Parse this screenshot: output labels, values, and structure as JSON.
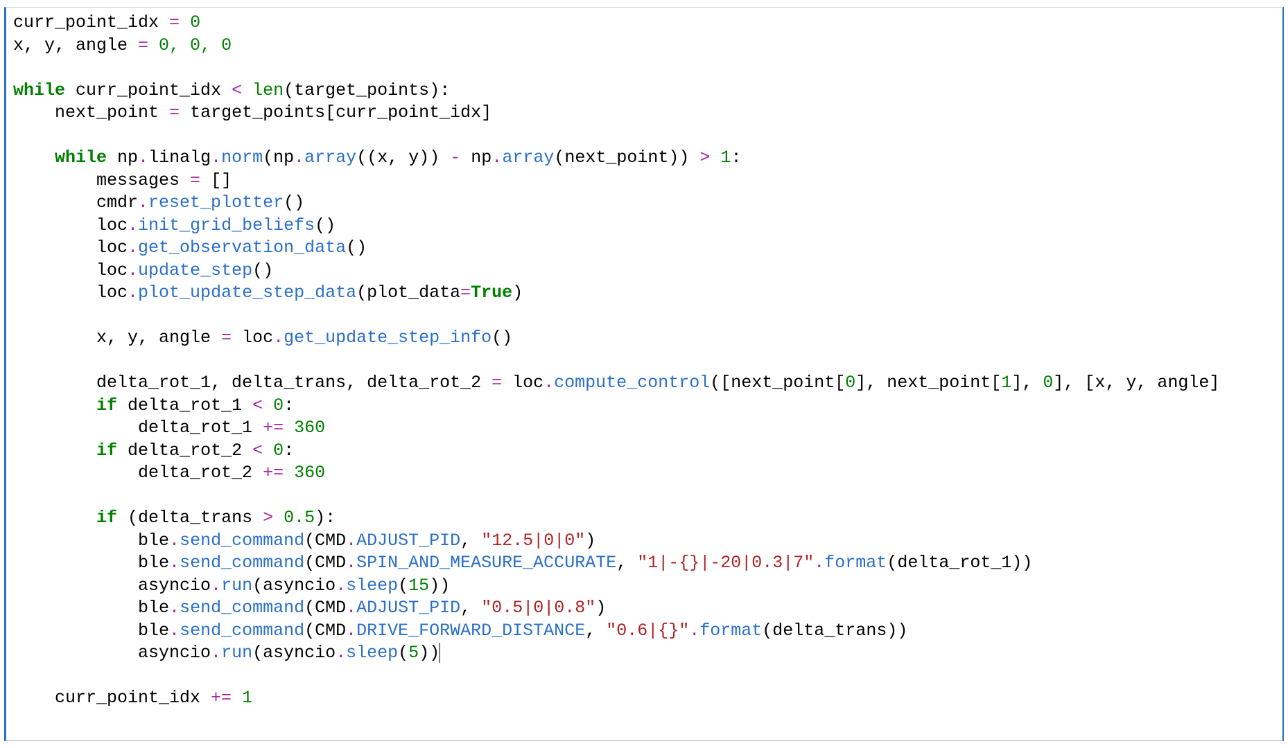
{
  "cell": {
    "interactable": true
  },
  "code": {
    "t": {
      "curr_point_idx": "curr_point_idx ",
      "eq": "=",
      "zero": " 0",
      "xya_lhs": "x, y, angle ",
      "zeros3": " 0, 0, 0",
      "kw_while": "while",
      "kw_if": "if",
      "sp": " ",
      "lt": "<",
      "gt": ">",
      "len": "len",
      "lp": "(",
      "rp": ")",
      "lb": "[",
      "rb": "]",
      "colon": ":",
      "dot": ".",
      "comma": ", ",
      "minus": "-",
      "plus_eq": "+=",
      "target_points": "target_points",
      "next_point_lhs": "    next_point ",
      "np": "np",
      "linalg": "linalg",
      "norm": "norm",
      "array": "array",
      "xy_tuple": "(x, y)",
      "next_point": "next_point",
      "one": " 1",
      "messages_line": "        messages ",
      "empty_list": " []",
      "cmdr": "        cmdr",
      "reset_plotter": "reset_plotter",
      "loc8": "        loc",
      "init_grid_beliefs": "init_grid_beliefs",
      "get_observation_data": "get_observation_data",
      "update_step": "update_step",
      "plot_update_step_data": "plot_update_step_data",
      "plot_data_kw": "plot_data",
      "True": "True",
      "xya_lhs8": "        x, y, angle ",
      "get_update_step_info": "get_update_step_info",
      "delta_lhs": "        delta_rot_1, delta_trans, delta_rot_2 ",
      "loc": " loc",
      "compute_control": "compute_control",
      "np0_open": "[next_point[",
      "np0_close": "], next_point[",
      "idx0": "0",
      "idx1": "1",
      "end_first_list": "], ",
      "snd_list": "], [x, y, angle]",
      "if_d1_lhs": "        ",
      "delta_rot_1": " delta_rot_1 ",
      "delta_rot_2": " delta_rot_2 ",
      "zero_plain": " 0",
      "d1_inc": "            delta_rot_1 ",
      "d2_inc": "            delta_rot_2 ",
      "n360": " 360",
      "delta_trans_cond_pre": " (delta_trans ",
      "p05": " 0.5",
      "ble12": "            ble",
      "send_command": "send_command",
      "CMD": "CMD",
      "ADJUST_PID": "ADJUST_PID",
      "SPIN_AND_MEASURE_ACCURATE": "SPIN_AND_MEASURE_ACCURATE",
      "DRIVE_FORWARD_DISTANCE": "DRIVE_FORWARD_DISTANCE",
      "s_1250": "\"12.5|0|0\"",
      "s_spin": "\"1|-{}|-20|0.3|7\"",
      "s_0508": "\"0.5|0|0.8\"",
      "s_drive": "\"0.6|{}\"",
      "format": "format",
      "delta_rot_1_arg": "delta_rot_1",
      "delta_trans_arg": "delta_trans",
      "asyncio12": "            asyncio",
      "run": "run",
      "asyncio": "asyncio",
      "sleep": "sleep",
      "n15": "15",
      "n5": "5",
      "cpi_inc": "    curr_point_idx ",
      "one_plain": " 1",
      "indent4": "    ",
      "indent8": "        "
    }
  }
}
